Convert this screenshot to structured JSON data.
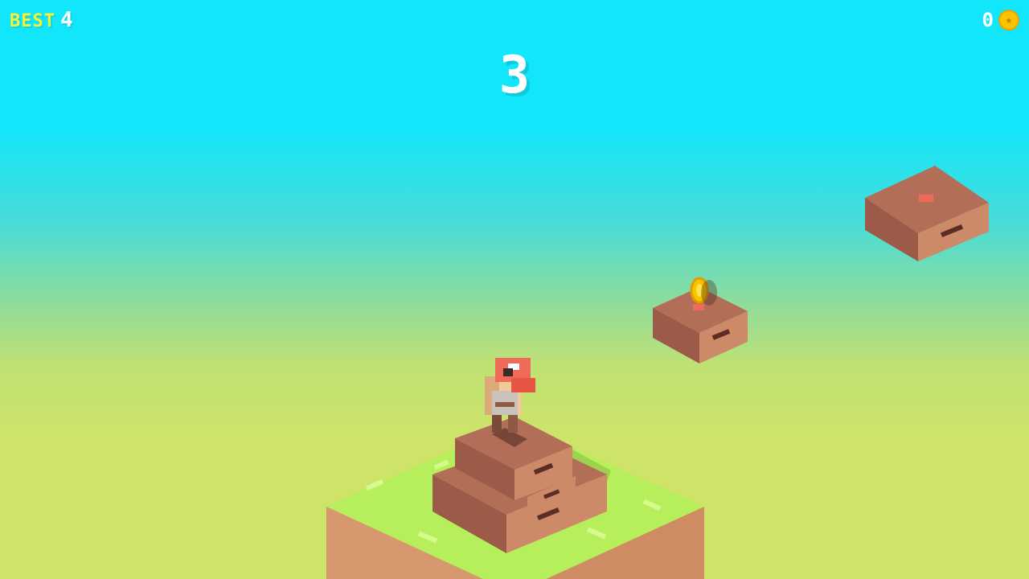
{
  "hud": {
    "best_label": "BEST",
    "best_value": "4",
    "coin_count": "0",
    "coin_icon": "coin-star-icon"
  },
  "score": "3",
  "colors": {
    "sky_top": "#12e6fb",
    "ground_glow": "#cde469",
    "best_label": "#f7f332",
    "coin": "#f7c400",
    "crate": "#a76452",
    "grass": "#b1ee58"
  },
  "scene": {
    "character": "red-capped-voxel-hero",
    "items": [
      "stone-island",
      "crate-platform",
      "crate-platform",
      "spinning-coin"
    ]
  }
}
